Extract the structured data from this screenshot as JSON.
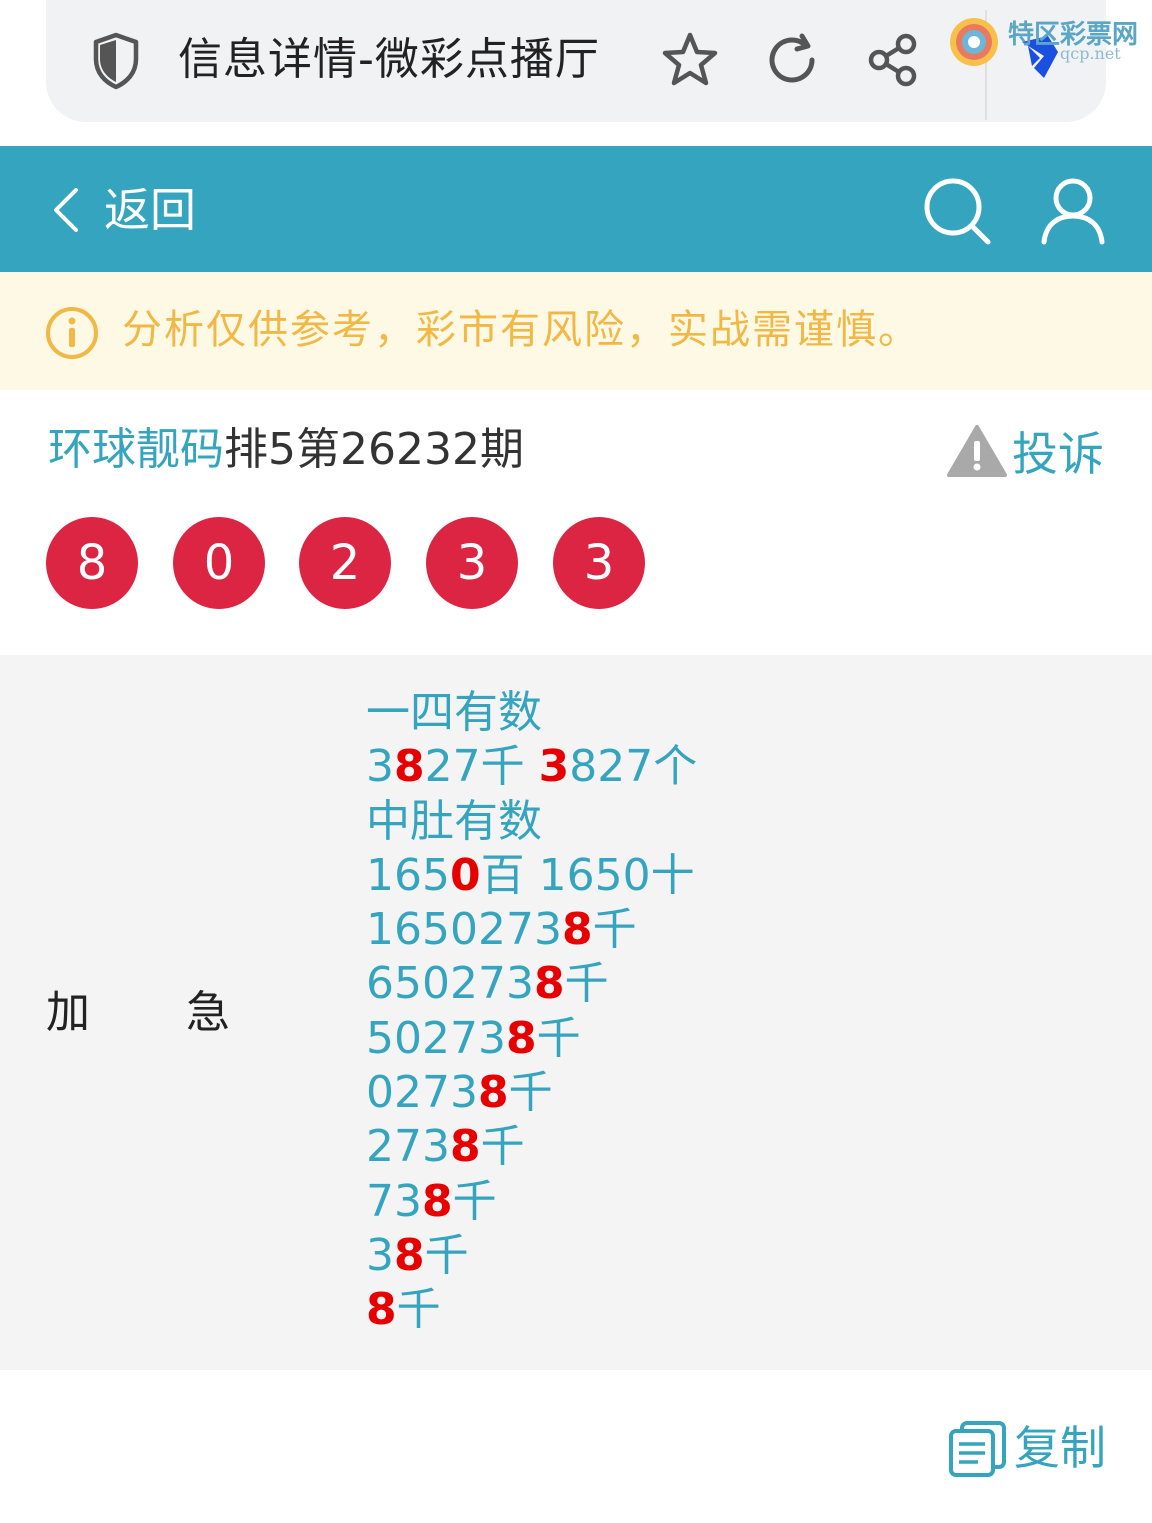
{
  "browser": {
    "title": "信息详情-微彩点播厅",
    "watermark_cn": "特区彩票网",
    "watermark_en": "qcp.net"
  },
  "header": {
    "back_label": "返回"
  },
  "warning": {
    "text": "分析仅供参考，彩市有风险，实战需谨慎。"
  },
  "post": {
    "author": "环球靓码",
    "title_rest": "排5第26232期",
    "report_label": "投诉"
  },
  "balls": [
    "8",
    "0",
    "2",
    "3",
    "3"
  ],
  "content": {
    "tag_left": "加",
    "tag_right": "急",
    "lines": [
      [
        {
          "t": "一四有数",
          "h": false
        }
      ],
      [
        {
          "t": "3",
          "h": false
        },
        {
          "t": "8",
          "h": true
        },
        {
          "t": "27千 ",
          "h": false
        },
        {
          "t": "3",
          "h": true
        },
        {
          "t": "827个",
          "h": false
        }
      ],
      [
        {
          "t": "中肚有数",
          "h": false
        }
      ],
      [
        {
          "t": "165",
          "h": false
        },
        {
          "t": "0",
          "h": true
        },
        {
          "t": "百 1650十",
          "h": false
        }
      ],
      [
        {
          "t": "1650273",
          "h": false
        },
        {
          "t": "8",
          "h": true
        },
        {
          "t": "千",
          "h": false
        }
      ],
      [
        {
          "t": "650273",
          "h": false
        },
        {
          "t": "8",
          "h": true
        },
        {
          "t": "千",
          "h": false
        }
      ],
      [
        {
          "t": "50273",
          "h": false
        },
        {
          "t": "8",
          "h": true
        },
        {
          "t": "千",
          "h": false
        }
      ],
      [
        {
          "t": "0273",
          "h": false
        },
        {
          "t": "8",
          "h": true
        },
        {
          "t": "千",
          "h": false
        }
      ],
      [
        {
          "t": "273",
          "h": false
        },
        {
          "t": "8",
          "h": true
        },
        {
          "t": "千",
          "h": false
        }
      ],
      [
        {
          "t": "73",
          "h": false
        },
        {
          "t": "8",
          "h": true
        },
        {
          "t": "千",
          "h": false
        }
      ],
      [
        {
          "t": "3",
          "h": false
        },
        {
          "t": "8",
          "h": true
        },
        {
          "t": "千",
          "h": false
        }
      ],
      [
        {
          "t": "8",
          "h": true
        },
        {
          "t": "千",
          "h": false
        }
      ]
    ]
  },
  "footer": {
    "copy_label": "复制"
  },
  "colors": {
    "accent": "#35a4bf",
    "ball": "#dc2542",
    "highlight": "#e60000",
    "warning_text": "#f2b845"
  }
}
